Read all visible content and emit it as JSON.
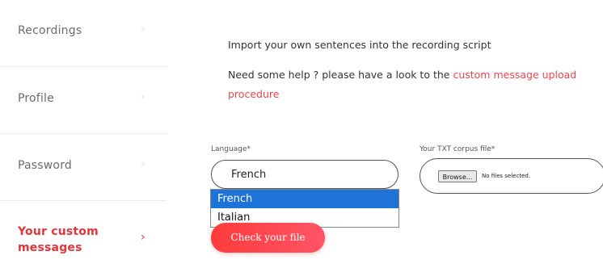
{
  "sidebar": {
    "items": [
      {
        "label": "Recordings",
        "active": false
      },
      {
        "label": "Profile",
        "active": false
      },
      {
        "label": "Password",
        "active": false
      },
      {
        "label": "Your custom messages",
        "label_line1": "Your custom",
        "label_line2": "messages",
        "active": true
      }
    ],
    "chevron": "›"
  },
  "main": {
    "intro": "Import your own sentences into the recording script",
    "help_text": "Need some help ? please have a look to the ",
    "help_link": "custom message upload procedure",
    "language_label": "Language*",
    "language_value": "French",
    "language_options": [
      {
        "label": "French",
        "selected": true
      },
      {
        "label": "Italian",
        "selected": false
      }
    ],
    "corpus_label": "Your TXT corpus file*",
    "browse_label": "Browse...",
    "file_status": "No files selected.",
    "check_button": "Check your file"
  },
  "colors": {
    "accent": "#e8323a",
    "link": "#f0444c",
    "selection": "#1e73d8"
  }
}
